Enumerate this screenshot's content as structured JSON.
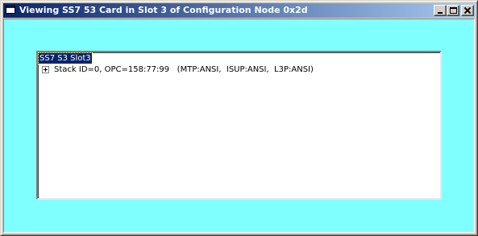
{
  "window": {
    "title": "Viewing SS7 53 Card in Slot 3 of Configuration Node 0x2d",
    "background_color": "#80ffff",
    "titlebar_color": "#0a246a"
  },
  "caption_buttons": {
    "minimize": "minimize-icon",
    "maximize": "maximize-icon",
    "close": "close-icon"
  },
  "tree": {
    "root": {
      "label": "SS7 S3 Slot3",
      "selected": true
    },
    "children": [
      {
        "label": "Stack ID=0, OPC=158:77:99   (MTP:ANSI,  ISUP:ANSI,  L3P:ANSI)",
        "expander": "plus-icon",
        "expanded": false
      }
    ]
  }
}
